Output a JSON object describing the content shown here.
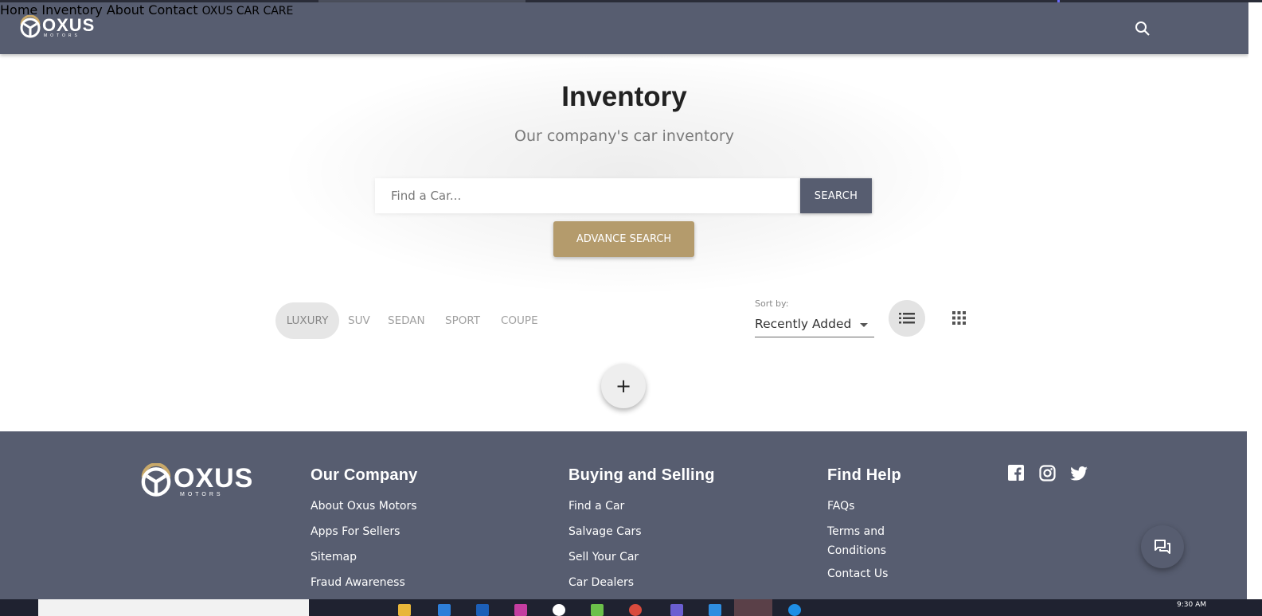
{
  "brand": {
    "name": "OXUS",
    "tagline": "MOTORS",
    "accent_color": "#b49b6c",
    "primary_color": "#575d70"
  },
  "nav": {
    "items": [
      "Home",
      "Inventory",
      "About",
      "Contact"
    ],
    "car_care": "OXUS CAR CARE",
    "search_icon": "search-icon"
  },
  "hero": {
    "title": "Inventory",
    "subtitle": "Our company's car inventory",
    "search_placeholder": "Find a Car...",
    "search_button": "SEARCH",
    "advance_search_button": "ADVANCE SEARCH"
  },
  "filters": {
    "categories": [
      "LUXURY",
      "SUV",
      "SEDAN",
      "SPORT",
      "COUPE"
    ],
    "active_category": "LUXURY",
    "sort_label": "Sort by:",
    "sort_value": "Recently Added",
    "view_icons": [
      "list-icon",
      "grid-icon"
    ]
  },
  "add_button": "+",
  "footer": {
    "columns": [
      {
        "heading": "Our Company",
        "links": [
          "About Oxus Motors",
          "Apps For Sellers",
          "Sitemap",
          "Fraud Awareness"
        ]
      },
      {
        "heading": "Buying and Selling",
        "links": [
          "Find a Car",
          "Salvage Cars",
          "Sell Your Car",
          "Car Dealers"
        ]
      },
      {
        "heading": "Find Help",
        "links": [
          "FAQs",
          "Terms and Conditions",
          "Contact Us"
        ]
      }
    ],
    "social_icons": [
      "facebook-icon",
      "instagram-icon",
      "twitter-icon"
    ],
    "chat_icon": "chat-icon"
  },
  "taskbar": {
    "clock": "9:30 AM"
  }
}
